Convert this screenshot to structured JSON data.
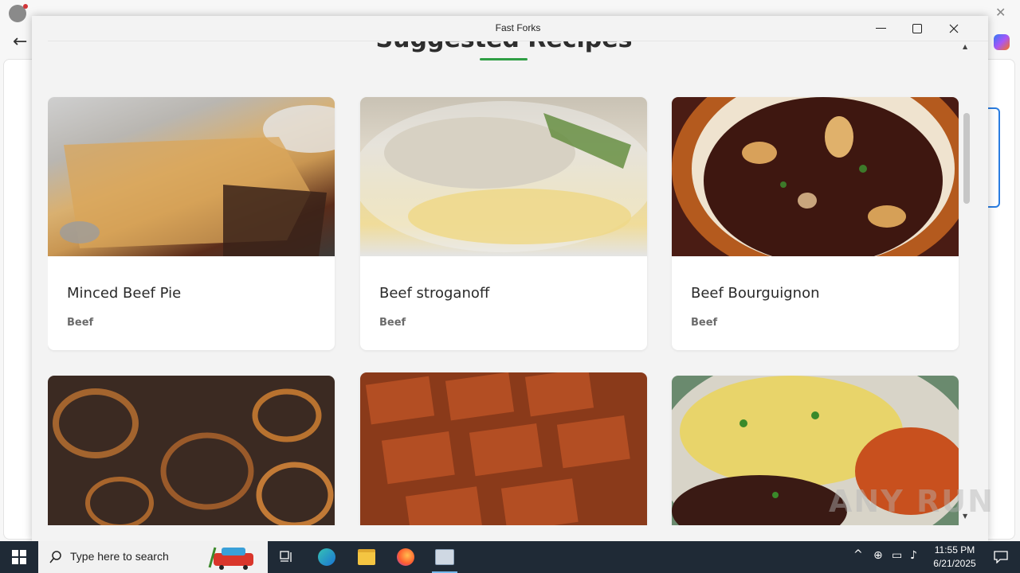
{
  "window": {
    "title": "Fast Forks"
  },
  "page": {
    "section_title": "Suggested Recipes"
  },
  "recipes": [
    {
      "name": "Minced Beef Pie",
      "category": "Beef"
    },
    {
      "name": "Beef stroganoff",
      "category": "Beef"
    },
    {
      "name": "Beef Bourguignon",
      "category": "Beef"
    },
    {
      "name": "",
      "category": ""
    },
    {
      "name": "",
      "category": ""
    },
    {
      "name": "",
      "category": ""
    }
  ],
  "watermark": "ANY RUN",
  "taskbar": {
    "search_placeholder": "Type here to search",
    "time": "11:55 PM",
    "date": "6/21/2025"
  },
  "colors": {
    "accent_underline": "#2f9e44",
    "taskbar": "#1f2a36"
  }
}
